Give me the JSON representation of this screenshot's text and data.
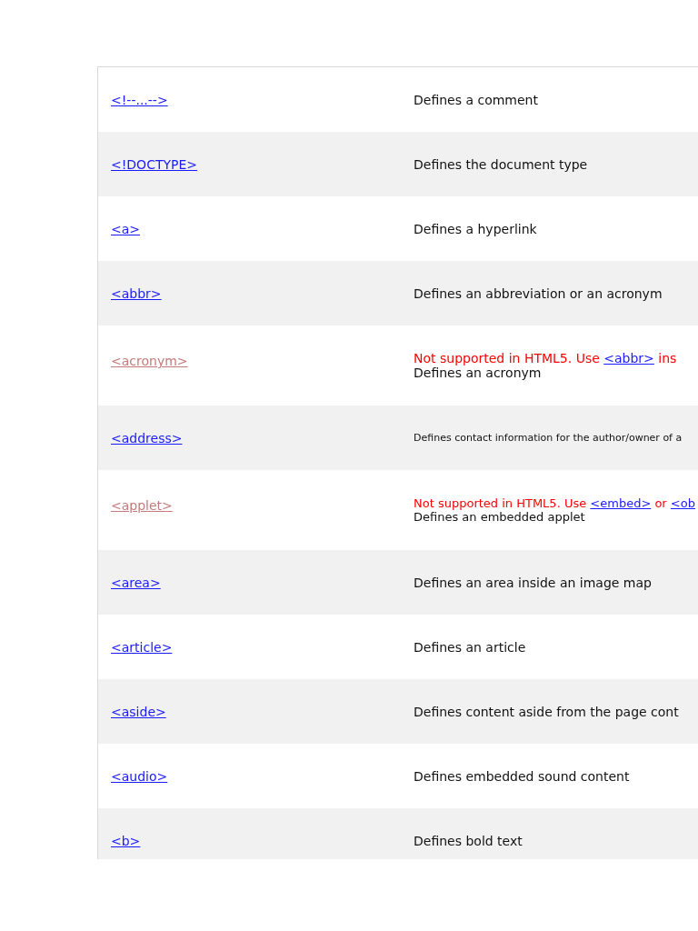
{
  "rows": [
    {
      "tag": "<!--...-->",
      "deprecated": false,
      "kind": "regular",
      "description": "Defines a comment"
    },
    {
      "tag": "<!DOCTYPE>",
      "deprecated": false,
      "kind": "regular",
      "description": "Defines the document type"
    },
    {
      "tag": "<a>",
      "deprecated": false,
      "kind": "regular",
      "description": "Defines a hyperlink"
    },
    {
      "tag": "<abbr>",
      "deprecated": false,
      "kind": "regular",
      "description": "Defines an abbreviation or an acronym"
    },
    {
      "tag": "<acronym>",
      "deprecated": true,
      "kind": "regular",
      "note": [
        {
          "kind": "text",
          "text": "Not supported in HTML5. Use "
        },
        {
          "kind": "link",
          "text": "<abbr>"
        },
        {
          "kind": "text",
          "text": " ins"
        }
      ],
      "description": "Defines an acronym"
    },
    {
      "tag": "<address>",
      "deprecated": false,
      "kind": "tiny",
      "description": "Defines contact information for the author/owner of a"
    },
    {
      "tag": "<applet>",
      "deprecated": true,
      "kind": "small",
      "note": [
        {
          "kind": "text",
          "text": "Not supported in HTML5. Use "
        },
        {
          "kind": "link",
          "text": "<embed>"
        },
        {
          "kind": "text",
          "text": " or "
        },
        {
          "kind": "link",
          "text": "<ob"
        }
      ],
      "description": "Defines an embedded applet"
    },
    {
      "tag": "<area>",
      "deprecated": false,
      "kind": "regular",
      "description": "Defines an area inside an image map"
    },
    {
      "tag": "<article>",
      "deprecated": false,
      "kind": "regular",
      "description": "Defines an article"
    },
    {
      "tag": "<aside>",
      "deprecated": false,
      "kind": "regular",
      "description": "Defines content aside from the page cont"
    },
    {
      "tag": "<audio>",
      "deprecated": false,
      "kind": "regular",
      "description": "Defines embedded sound content"
    },
    {
      "tag": "<b>",
      "deprecated": false,
      "kind": "regular",
      "description": "Defines bold text"
    }
  ]
}
